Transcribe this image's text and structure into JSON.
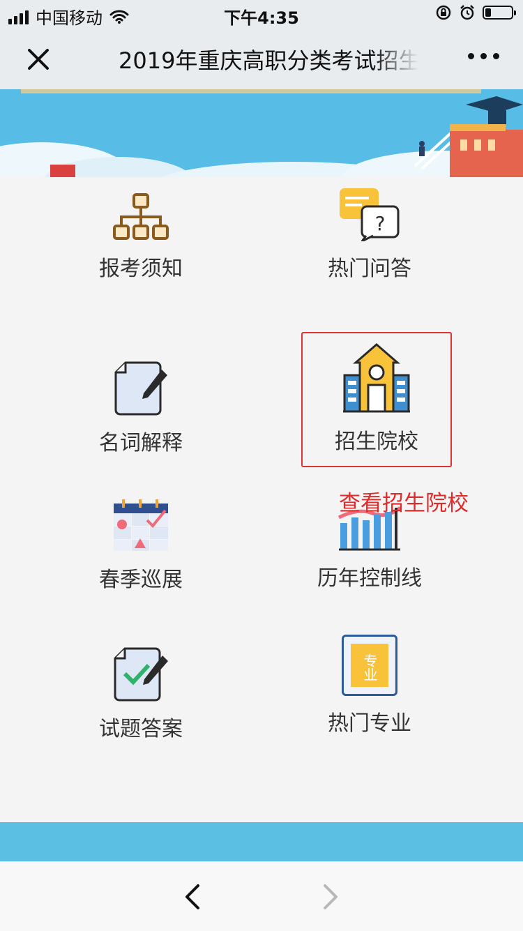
{
  "status_bar": {
    "carrier": "中国移动",
    "time": "下午4:35"
  },
  "nav": {
    "title": "2019年重庆高职分类考试招生",
    "close_icon": "close-icon",
    "more_icon": "more-icon"
  },
  "menu": {
    "items": [
      {
        "label": "报考须知",
        "icon": "org-chart-icon"
      },
      {
        "label": "热门问答",
        "icon": "question-chat-icon"
      },
      {
        "label": "名词解释",
        "icon": "note-edit-icon"
      },
      {
        "label": "招生院校",
        "icon": "school-building-icon"
      },
      {
        "label": "春季巡展",
        "icon": "calendar-icon"
      },
      {
        "label": "历年控制线",
        "icon": "bar-chart-icon"
      },
      {
        "label": "试题答案",
        "icon": "checked-note-icon"
      },
      {
        "label": "热门专业",
        "icon": "major-badge-icon"
      }
    ],
    "major_badge_text": "专业"
  },
  "annotation": {
    "text": "查看招生院校",
    "color": "#e02b2b"
  },
  "colors": {
    "banner": "#57bde6",
    "bottom_band": "#5bbfe4",
    "highlight": "#e03434"
  },
  "toolbar": {
    "back_icon": "chevron-left-icon",
    "forward_icon": "chevron-right-icon"
  }
}
